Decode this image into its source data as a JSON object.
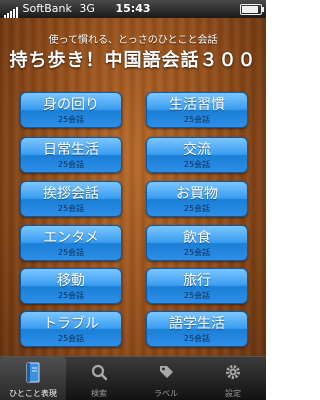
{
  "status": {
    "carrier": "SoftBank",
    "network": "3G",
    "time": "15:43"
  },
  "header": {
    "tagline": "使って慣れる、とっさのひとこと会話",
    "title": "持ち歩き！中国語会話３００"
  },
  "categories": [
    {
      "name": "身の回り",
      "count": "25会話"
    },
    {
      "name": "生活習慣",
      "count": "25会話"
    },
    {
      "name": "日常生活",
      "count": "25会話"
    },
    {
      "name": "交流",
      "count": "25会話"
    },
    {
      "name": "挨拶会話",
      "count": "25会話"
    },
    {
      "name": "お買物",
      "count": "25会話"
    },
    {
      "name": "エンタメ",
      "count": "25会話"
    },
    {
      "name": "飲食",
      "count": "25会話"
    },
    {
      "name": "移動",
      "count": "25会話"
    },
    {
      "name": "旅行",
      "count": "25会話"
    },
    {
      "name": "トラブル",
      "count": "25会話"
    },
    {
      "name": "語学生活",
      "count": "25会話"
    }
  ],
  "tabs": [
    {
      "label": "ひとこと表現",
      "icon": "book-icon",
      "active": true
    },
    {
      "label": "検索",
      "icon": "search-icon",
      "active": false
    },
    {
      "label": "ラベル",
      "icon": "tag-icon",
      "active": false
    },
    {
      "label": "設定",
      "icon": "gear-icon",
      "active": false
    }
  ]
}
